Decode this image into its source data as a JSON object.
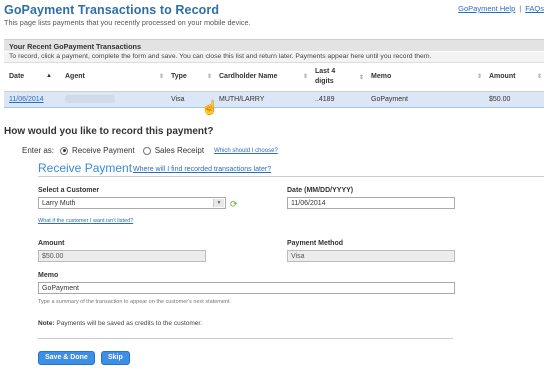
{
  "header": {
    "title": "GoPayment Transactions to Record",
    "subtitle": "This page lists payments that you recently processed on your mobile device.",
    "help_link": "GoPayment Help",
    "sep": "|",
    "faqs_link": "FAQs"
  },
  "panel": {
    "title": "Your Recent GoPayment Transactions",
    "instruction": "To record, click a payment, complete the form and save. You can close this list and return later. Payments appear here until you record them."
  },
  "table": {
    "columns": {
      "date": "Date",
      "agent": "Agent",
      "type": "Type",
      "cardholder": "Cardholder Name",
      "last4_a": "Last 4",
      "last4_b": "digits",
      "memo": "Memo",
      "amount": "Amount"
    },
    "sort_up": "▲",
    "sort_both": "⇕",
    "rows": [
      {
        "date": "11/06/2014",
        "agent": "",
        "type": "Visa",
        "cardholder": "MUTH/LARRY",
        "last4": "..4189",
        "memo": "GoPayment",
        "amount": "$50.00"
      }
    ]
  },
  "record": {
    "question": "How would you like to record this payment?",
    "enter_as": "Enter as:",
    "option_receive": "Receive Payment",
    "option_receipt": "Sales Receipt",
    "which_link": "Which should I choose?"
  },
  "form": {
    "title": "Receive Payment",
    "where_link": "Where will I find recorded transactions later?",
    "customer_label": "Select a Customer",
    "customer_value": "Larry Muth",
    "refresh_icon": "⟳",
    "not_listed_link": "What if the customer I want isn't listed?",
    "date_label": "Date (MM/DD/YYYY)",
    "date_value": "11/06/2014",
    "amount_label": "Amount",
    "amount_value": "$50.00",
    "method_label": "Payment Method",
    "method_value": "Visa",
    "memo_label": "Memo",
    "memo_value": "GoPayment",
    "memo_hint": "Type a summary of the transaction to appear on the customer's next statement.",
    "note_label": "Note:",
    "note_text": "Payments will be saved as credits to the customer.",
    "save_button": "Save & Done",
    "skip_button": "Skip"
  },
  "colors": {
    "accent": "#3c8ee6",
    "title": "#2f6fa8",
    "link": "#2a6cc4",
    "row_highlight": "#dbe7f6"
  }
}
